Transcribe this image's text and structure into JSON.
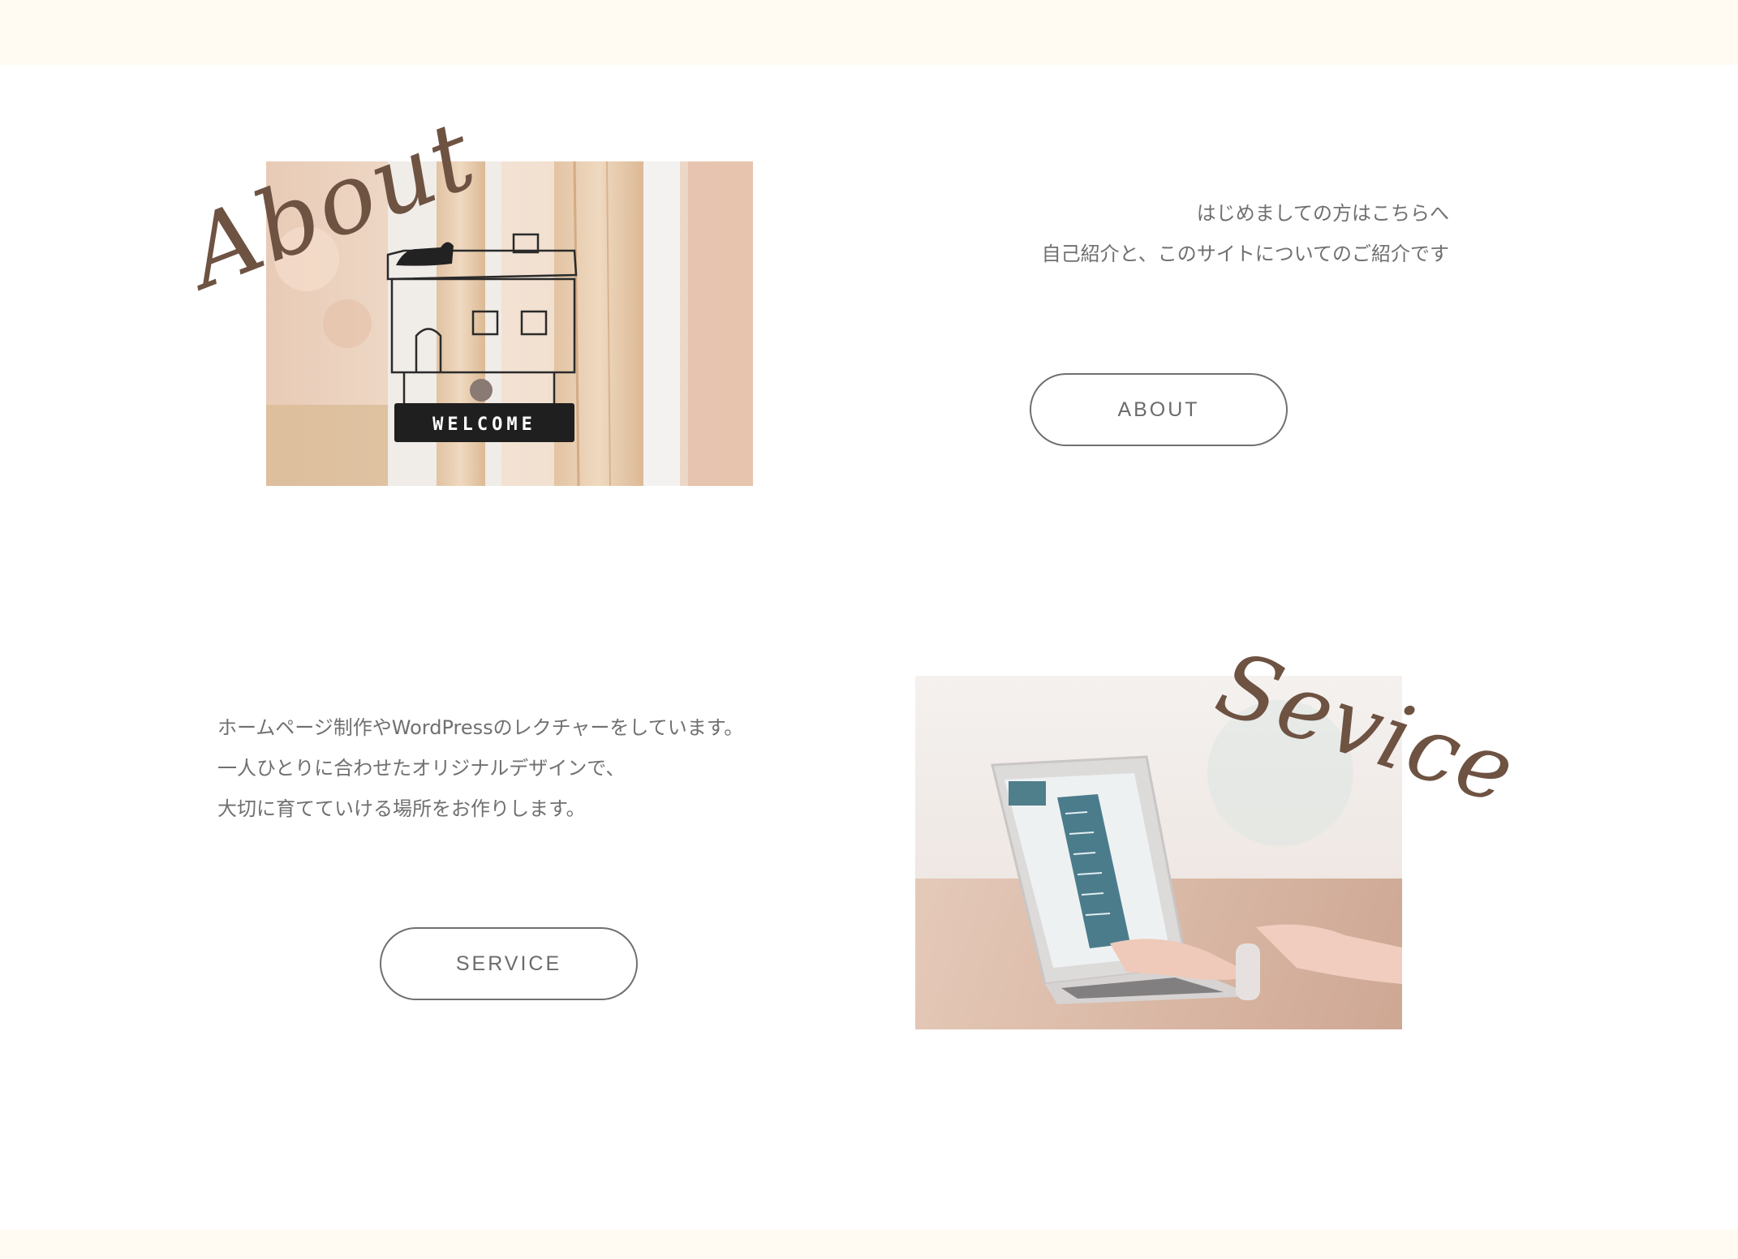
{
  "about": {
    "script_title": "About",
    "sign_text": "WELCOME",
    "lines": [
      "はじめましての方はこちらへ",
      "自己紹介と、このサイトについてのご紹介です"
    ],
    "button_label": "ABOUT"
  },
  "service": {
    "script_title": "Sevice",
    "lines": [
      "ホームページ制作やWordPressのレクチャーをしています。",
      "一人ひとりに合わせたオリジナルデザインで、",
      "大切に育てていける場所をお作りします。"
    ],
    "button_label": "SERVICE"
  },
  "colors": {
    "band": "#fffaf2",
    "script": "#6e5242",
    "text": "#707070",
    "button_border": "#707070"
  }
}
